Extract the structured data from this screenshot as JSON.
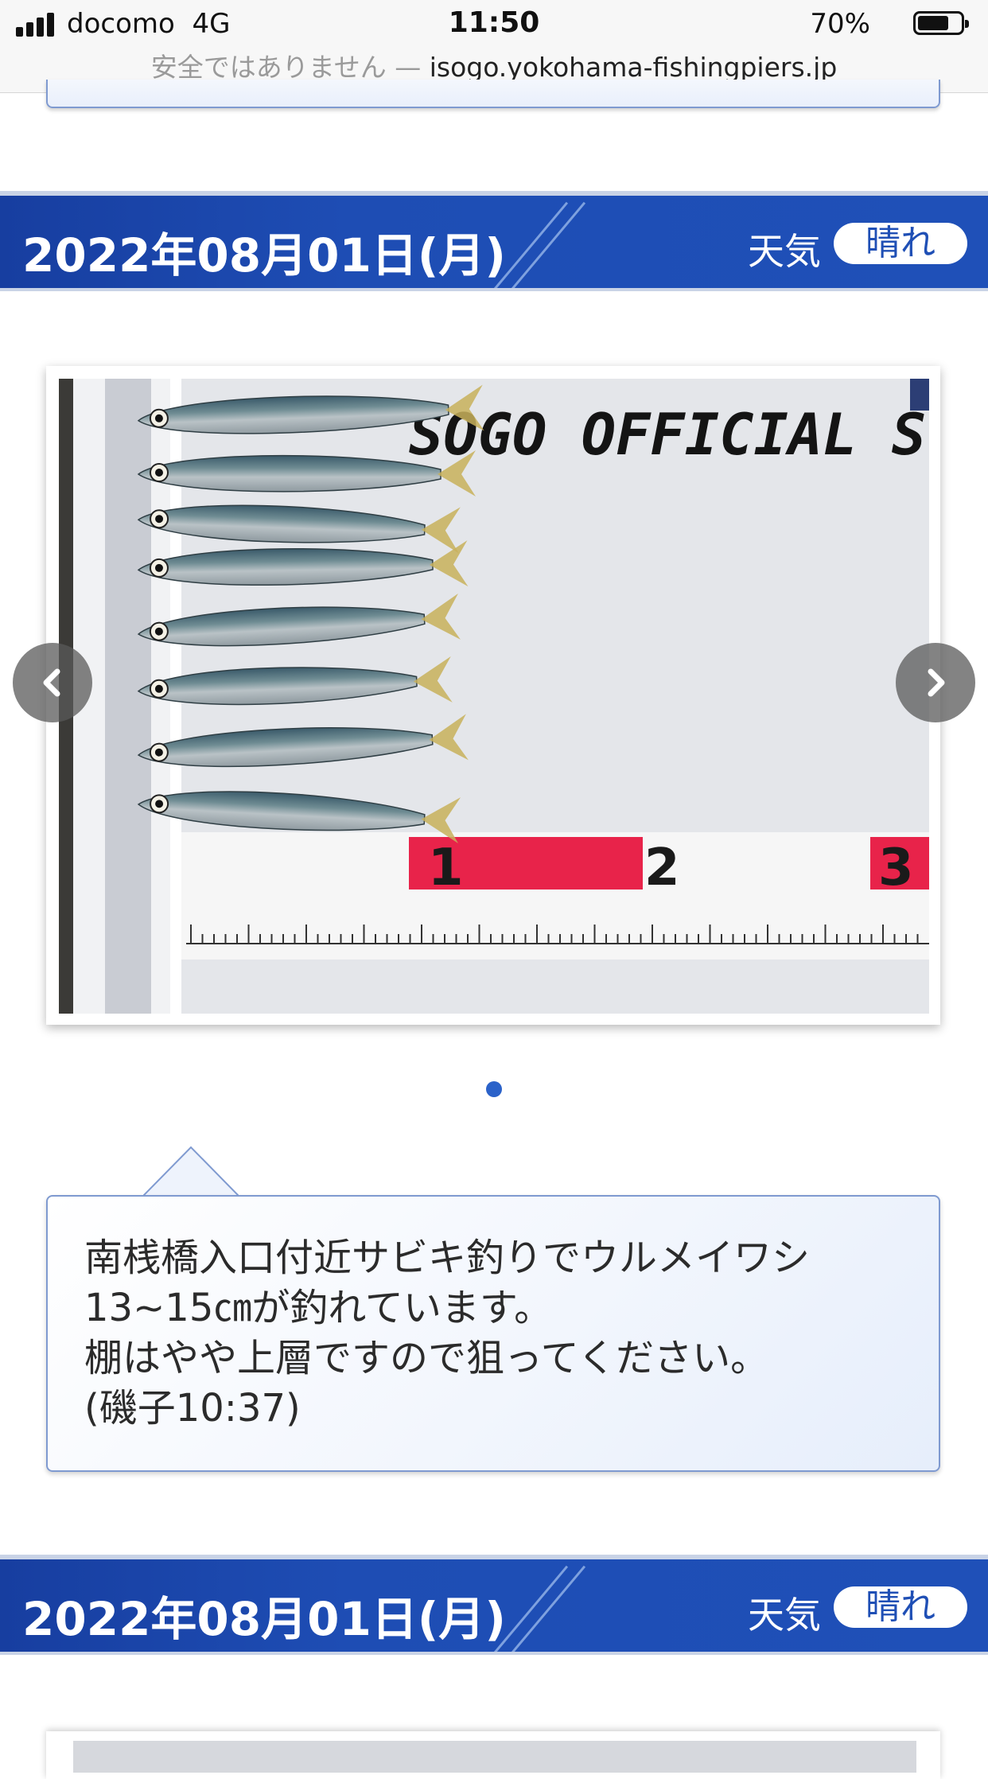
{
  "status_bar": {
    "carrier": "docomo",
    "network": "4G",
    "time": "11:50",
    "battery_percent": "70%"
  },
  "browser": {
    "insecure_label": "安全ではありません — ",
    "host": "isogo.yokohama-fishingpiers.jp"
  },
  "entries": [
    {
      "date": "2022年08月01日(月)",
      "weather_label": "天気",
      "weather_value": "晴れ",
      "photo_sign_text": "SOGO OFFICIAL SC",
      "ruler_numbers": [
        "1",
        "2",
        "3"
      ],
      "comment": "南桟橋入口付近サビキ釣りでウルメイワシ\n13~15㎝が釣れています。\n棚はやや上層ですので狙ってください。\n(磯子10:37)"
    },
    {
      "date": "2022年08月01日(月)",
      "weather_label": "天気",
      "weather_value": "晴れ"
    }
  ],
  "carousel": {
    "prev_icon": "chevron-left-icon",
    "next_icon": "chevron-right-icon",
    "dots": 1,
    "active_dot_color": "#2b62c9"
  },
  "colors": {
    "header_blue": "#1e4db4",
    "card_border": "#7f9ad0"
  }
}
